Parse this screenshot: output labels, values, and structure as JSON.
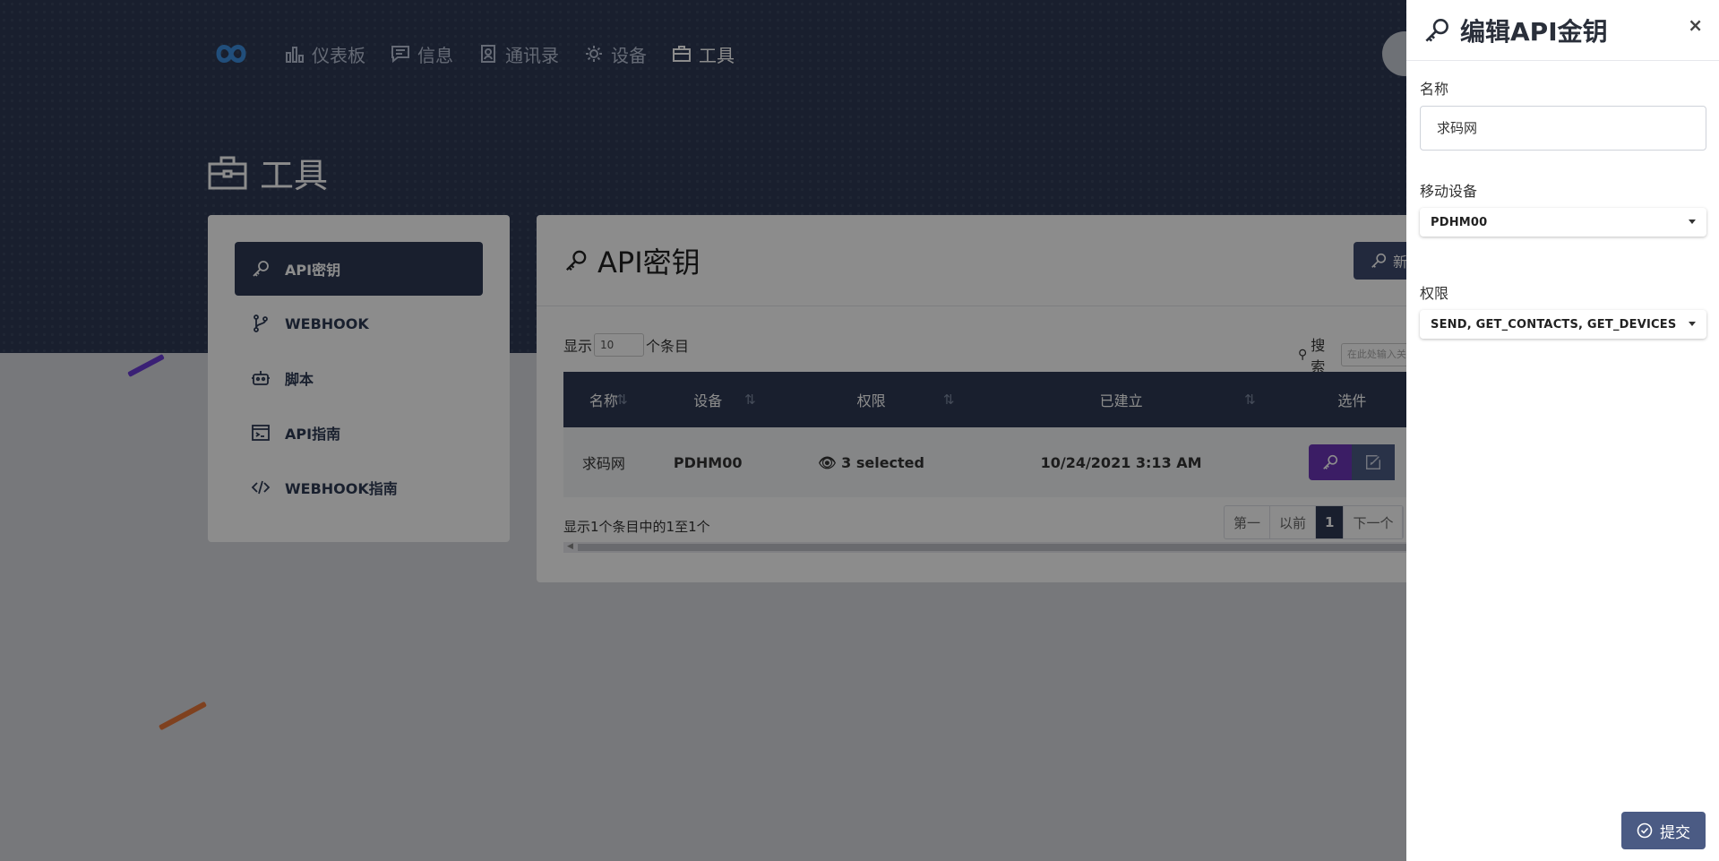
{
  "nav": {
    "items": [
      {
        "label": "仪表板",
        "icon": "bar-chart-icon"
      },
      {
        "label": "信息",
        "icon": "message-icon"
      },
      {
        "label": "通讯录",
        "icon": "contacts-icon"
      },
      {
        "label": "设备",
        "icon": "gear-icon"
      },
      {
        "label": "工具",
        "icon": "briefcase-icon"
      }
    ]
  },
  "page": {
    "title": "工具"
  },
  "sidebar": {
    "items": [
      {
        "label": "API密钥",
        "icon": "key-icon"
      },
      {
        "label": "WEBHOOK",
        "icon": "branch-icon"
      },
      {
        "label": "脚本",
        "icon": "robot-icon"
      },
      {
        "label": "API指南",
        "icon": "terminal-icon"
      },
      {
        "label": "WEBHOOK指南",
        "icon": "code-icon"
      }
    ]
  },
  "panel": {
    "title": "API密钥",
    "new_button": "新"
  },
  "table": {
    "show_label": "显示",
    "length_value": "10",
    "entries_label": "个条目",
    "search_label": "搜索",
    "search_placeholder": "在此处输入关键",
    "columns": [
      "名称",
      "设备",
      "权限",
      "已建立",
      "选件"
    ],
    "rows": [
      {
        "name": "求码网",
        "device": "PDHM00",
        "permissions": "3 selected",
        "created": "10/24/2021 3:13 AM"
      }
    ],
    "info": "显示1个条目中的1至1个",
    "pager": {
      "first": "第一",
      "prev": "以前",
      "current": "1",
      "next": "下一个"
    }
  },
  "drawer": {
    "title": "编辑API金钥",
    "close": "×",
    "name_label": "名称",
    "name_value": "求码网",
    "device_label": "移动设备",
    "device_value": "PDHM00",
    "permissions_label": "权限",
    "permissions_value": "SEND, GET_CONTACTS, GET_DEVICES",
    "submit_label": "提交"
  },
  "colors": {
    "navy": "#2e3a55",
    "purple": "#6c35b8",
    "slate_button": "#4b5b84"
  }
}
